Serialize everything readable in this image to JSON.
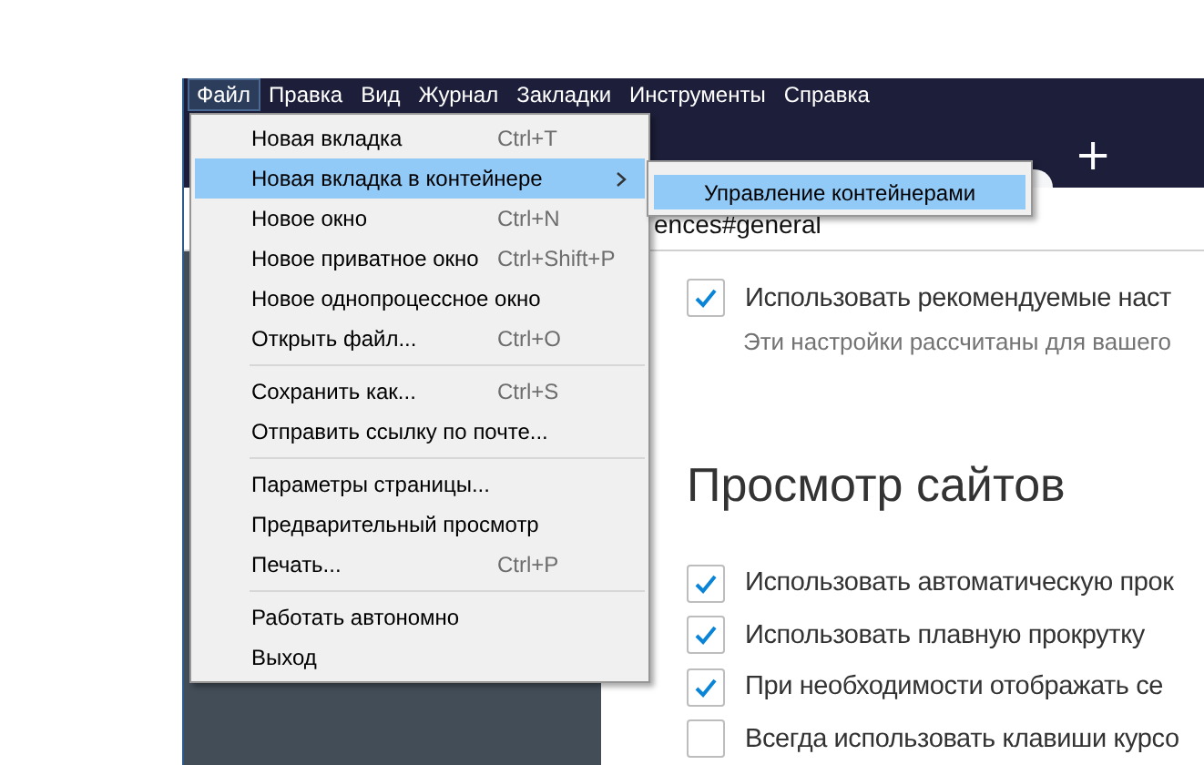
{
  "menubar": [
    {
      "label": "Файл",
      "selected": true
    },
    {
      "label": "Правка",
      "selected": false
    },
    {
      "label": "Вид",
      "selected": false
    },
    {
      "label": "Журнал",
      "selected": false
    },
    {
      "label": "Закладки",
      "selected": false
    },
    {
      "label": "Инструменты",
      "selected": false
    },
    {
      "label": "Справка",
      "selected": false
    }
  ],
  "file_menu": {
    "groups": [
      [
        {
          "label": "Новая вкладка",
          "shortcut": "Ctrl+T",
          "selected": false,
          "submenu": false
        },
        {
          "label": "Новая вкладка в контейнере",
          "selected": true,
          "submenu": true
        },
        {
          "label": "Новое окно",
          "shortcut": "Ctrl+N",
          "selected": false,
          "submenu": false
        },
        {
          "label": "Новое приватное окно",
          "shortcut": "Ctrl+Shift+P",
          "selected": false,
          "submenu": false
        },
        {
          "label": "Новое однопроцессное окно",
          "selected": false,
          "submenu": false
        },
        {
          "label": "Открыть файл...",
          "shortcut": "Ctrl+O",
          "selected": false,
          "submenu": false
        }
      ],
      [
        {
          "label": "Сохранить как...",
          "shortcut": "Ctrl+S",
          "selected": false,
          "submenu": false
        },
        {
          "label": "Отправить ссылку по почте...",
          "selected": false,
          "submenu": false
        }
      ],
      [
        {
          "label": "Параметры страницы...",
          "selected": false,
          "submenu": false
        },
        {
          "label": "Предварительный просмотр",
          "selected": false,
          "submenu": false
        },
        {
          "label": "Печать...",
          "shortcut": "Ctrl+P",
          "selected": false,
          "submenu": false
        }
      ],
      [
        {
          "label": "Работать автономно",
          "selected": false,
          "submenu": false
        },
        {
          "label": "Выход",
          "selected": false,
          "submenu": false
        }
      ]
    ]
  },
  "submenu": {
    "items": [
      {
        "label": "Управление контейнерами",
        "selected": true
      }
    ]
  },
  "tab_strip": {
    "new_tab_button": "+"
  },
  "address_bar": {
    "value": "ences#general"
  },
  "content": {
    "top_option": {
      "label": "Использовать рекомендуемые наст",
      "checked": true,
      "description": "Эти настройки рассчитаны для вашего"
    },
    "section_title": "Просмотр сайтов",
    "options": [
      {
        "label": "Использовать автоматическую прок",
        "checked": true
      },
      {
        "label": "Использовать плавную прокрутку",
        "checked": true
      },
      {
        "label": "При необходимости отображать се",
        "checked": true
      },
      {
        "label": "Всегда использовать клавиши курсо",
        "checked": false
      }
    ]
  }
}
